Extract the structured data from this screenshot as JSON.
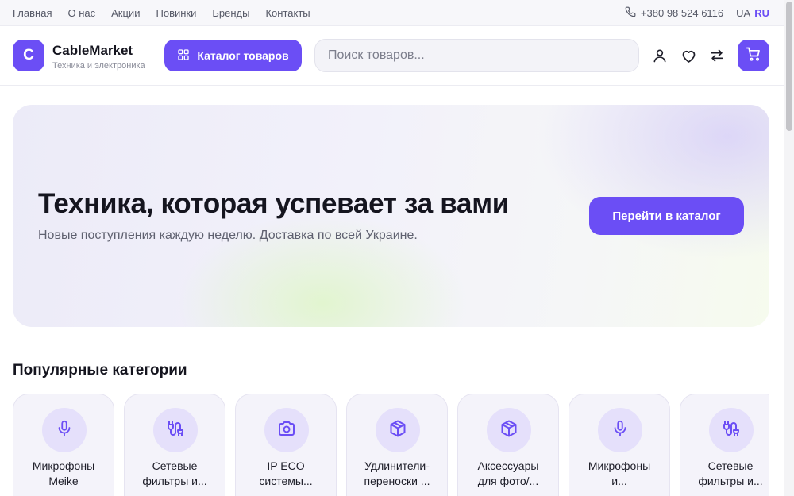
{
  "topbar": {
    "nav": [
      "Главная",
      "О нас",
      "Акции",
      "Новинки",
      "Бренды",
      "Контакты"
    ],
    "phone": "+380 98 524 6116",
    "languages": [
      "UA",
      "RU"
    ],
    "active_language": "RU"
  },
  "header": {
    "logo_letter": "C",
    "brand_name": "CableMarket",
    "brand_tagline": "Техника и электроника",
    "catalog_label": "Каталог товаров",
    "search_placeholder": "Поиск товаров..."
  },
  "hero": {
    "title": "Техника, которая успевает за вами",
    "subtitle": "Новые поступления каждую неделю. Доставка по всей Украине.",
    "cta": "Перейти в каталог"
  },
  "categories": {
    "title": "Популярные категории",
    "items": [
      {
        "line1": "Микрофоны",
        "line2": "Meike",
        "icon": "microphone-icon"
      },
      {
        "line1": "Сетевые",
        "line2": "фильтры и...",
        "icon": "plug-icon"
      },
      {
        "line1": "IP ECO",
        "line2": "системы...",
        "icon": "camera-icon"
      },
      {
        "line1": "Удлинители-",
        "line2": "переноски ...",
        "icon": "box-icon"
      },
      {
        "line1": "Аксессуары",
        "line2": "для фото/...",
        "icon": "box-icon"
      },
      {
        "line1": "Микрофоны",
        "line2": "и...",
        "icon": "microphone-icon"
      },
      {
        "line1": "Сетевые",
        "line2": "фильтры и...",
        "icon": "plug-icon"
      }
    ]
  },
  "colors": {
    "accent": "#6b4ef5",
    "icon_circle": "#e5e0fb",
    "card_bg": "#f4f3fa"
  }
}
